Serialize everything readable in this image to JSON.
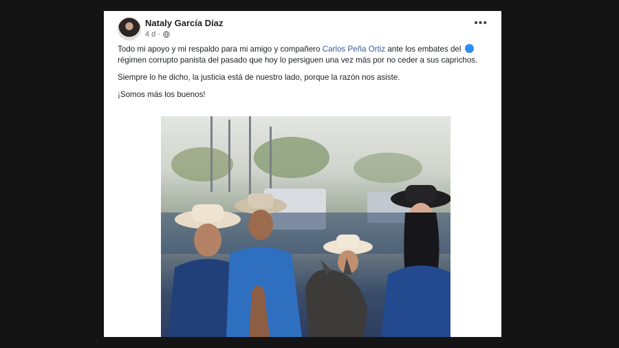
{
  "post": {
    "author": "Nataly García Díaz",
    "time": "4 d ·",
    "paragraphs": {
      "p1_before": "Todo mi apoyo y mi respaldo para mi amigo y compañero ",
      "p1_mention": "Carlos Peña Ortiz",
      "p1_after": " ante los embates del ",
      "p1_rest": "régimen corrupto panista del pasado que hoy lo persiguen una vez más por no ceder a sus caprichos.",
      "p2": "Siempre lo he dicho, la justicia está de nuestro lado, porque la razón nos asiste.",
      "p3": "¡Somos más los buenos!"
    },
    "more_label": "•••"
  },
  "icons": {
    "globe": "globe-icon",
    "more": "more-icon",
    "emoji": "blue-circle-emoji"
  },
  "colors": {
    "mention": "#385898",
    "background": "#141414"
  }
}
